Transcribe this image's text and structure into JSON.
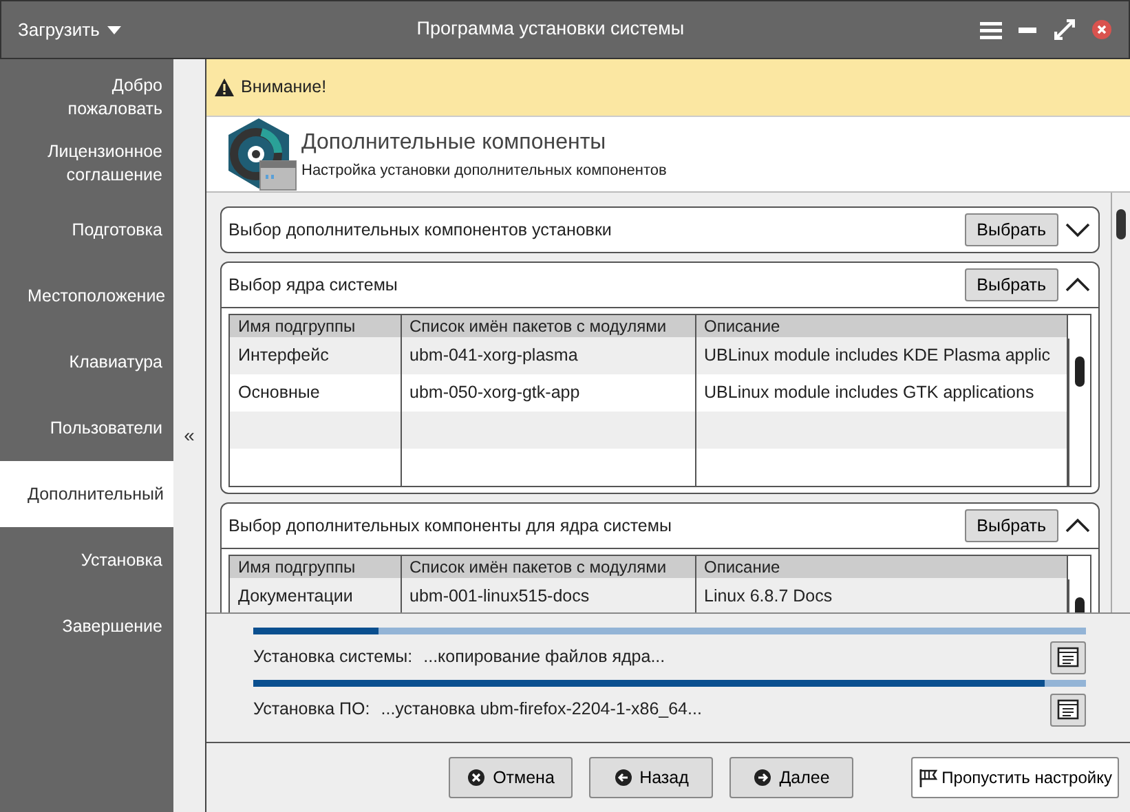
{
  "window": {
    "title": "Программа установки системы",
    "menu_button": "Загрузить"
  },
  "sidebar": {
    "collapse": "«",
    "items": [
      {
        "label": "Добро пожаловать",
        "selected": false
      },
      {
        "label": "Лицензионное соглашение",
        "selected": false
      },
      {
        "label": "Подготовка",
        "selected": false
      },
      {
        "label": "Местоположение",
        "selected": false
      },
      {
        "label": "Клавиатура",
        "selected": false
      },
      {
        "label": "Пользователи",
        "selected": false
      },
      {
        "label": "Дополнительный",
        "selected": true
      },
      {
        "label": "Установка",
        "selected": false
      },
      {
        "label": "Завершение",
        "selected": false
      }
    ]
  },
  "warning": "Внимание!",
  "header": {
    "title": "Дополнительные компоненты",
    "subtitle": "Настройка установки дополнительных компонентов"
  },
  "sections": [
    {
      "title": "Выбор дополнительных компонентов установки",
      "button": "Выбрать",
      "expanded": false
    },
    {
      "title": "Выбор ядра системы",
      "button": "Выбрать",
      "expanded": true,
      "columns": [
        "Имя подгруппы",
        "Список имён пакетов с модулями",
        "Описание"
      ],
      "rows": [
        [
          "Интерфейс",
          "ubm-041-xorg-plasma",
          "UBLinux module includes KDE Plasma applic"
        ],
        [
          "Основные",
          "ubm-050-xorg-gtk-app",
          "UBLinux module includes GTK applications"
        ]
      ]
    },
    {
      "title": "Выбор дополнительных компоненты для ядра системы",
      "button": "Выбрать",
      "expanded": true,
      "columns": [
        "Имя подгруппы",
        "Список имён пакетов с модулями",
        "Описание"
      ],
      "rows": [
        [
          "Документации",
          "ubm-001-linux515-docs",
          "Linux 6.8.7 Docs"
        ]
      ]
    }
  ],
  "progress": [
    {
      "label": "Установка системы:",
      "status": "...копирование файлов ядра...",
      "level": 0.15
    },
    {
      "label": "Установка ПО:",
      "status": "...установка ubm-firefox-2204-1-x86_64...",
      "level": 0.95
    }
  ],
  "buttons": [
    {
      "label": "Отмена",
      "kind": "cancel"
    },
    {
      "label": "Назад",
      "kind": "back"
    },
    {
      "label": "Далее",
      "kind": "next"
    },
    {
      "label": "Пропустить настройку",
      "kind": "skip"
    }
  ]
}
